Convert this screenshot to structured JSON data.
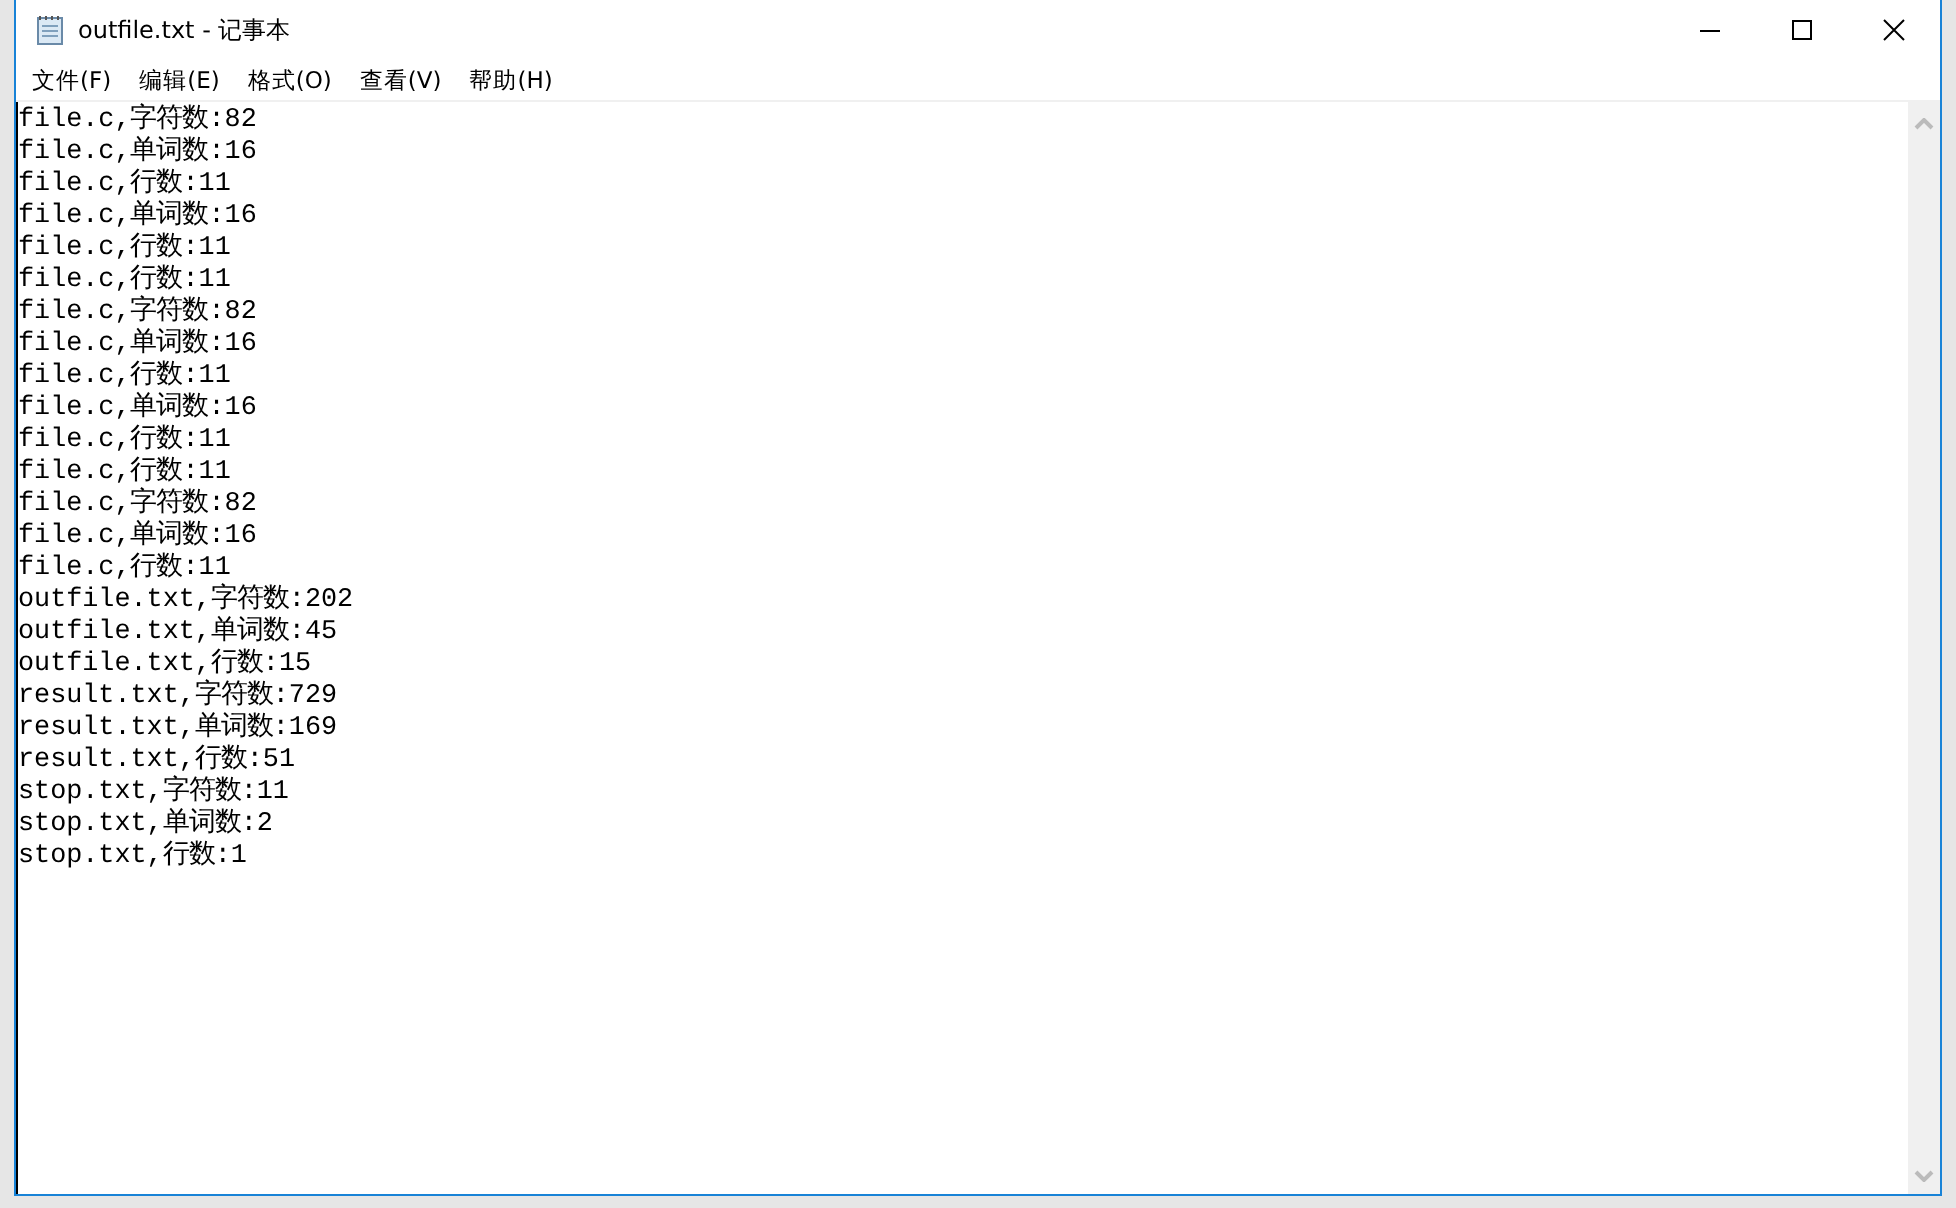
{
  "window": {
    "title": "outfile.txt - 记事本"
  },
  "menu": [
    {
      "label": "文件(F)"
    },
    {
      "label": "编辑(E)"
    },
    {
      "label": "格式(O)"
    },
    {
      "label": "查看(V)"
    },
    {
      "label": "帮助(H)"
    }
  ],
  "editor": {
    "lines": [
      "file.c,字符数:82",
      "file.c,单词数:16",
      "file.c,行数:11",
      "file.c,单词数:16",
      "file.c,行数:11",
      "file.c,行数:11",
      "file.c,字符数:82",
      "file.c,单词数:16",
      "file.c,行数:11",
      "file.c,单词数:16",
      "file.c,行数:11",
      "file.c,行数:11",
      "file.c,字符数:82",
      "file.c,单词数:16",
      "file.c,行数:11",
      "outfile.txt,字符数:202",
      "outfile.txt,单词数:45",
      "outfile.txt,行数:15",
      "result.txt,字符数:729",
      "result.txt,单词数:169",
      "result.txt,行数:51",
      "stop.txt,字符数:11",
      "stop.txt,单词数:2",
      "stop.txt,行数:1"
    ]
  }
}
